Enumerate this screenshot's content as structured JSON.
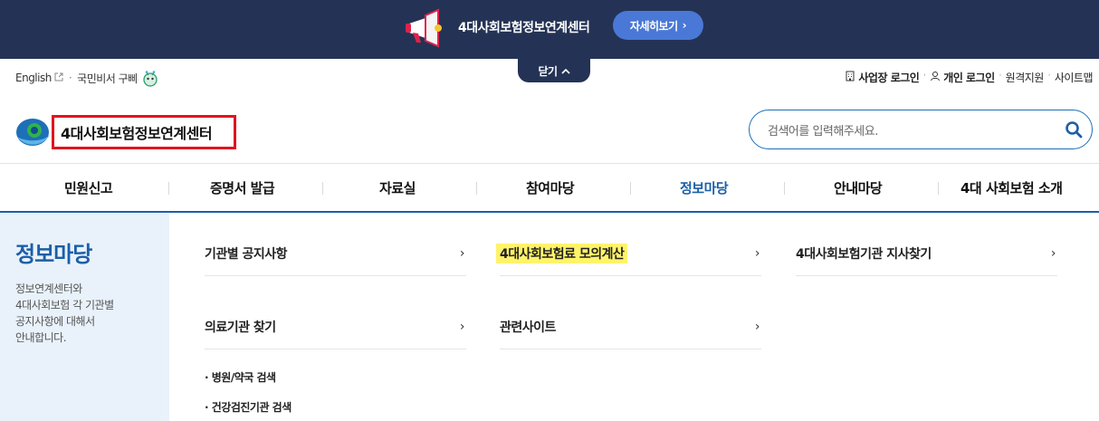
{
  "banner": {
    "title": "4대사회보험정보연계센터",
    "more_label": "자세히보기",
    "more_icon": "chevron-right-icon",
    "close_label": "닫기",
    "close_icon": "chevron-up-icon"
  },
  "util": {
    "english_label": "English",
    "secretary_label": "국민비서 구삐",
    "business_login": "사업장 로그인",
    "personal_login": "개인 로그인",
    "remote_support": "원격지원",
    "sitemap": "사이트맵"
  },
  "logo": {
    "text": "4대사회보험정보연계센터"
  },
  "search": {
    "placeholder": "검색어를 입력해주세요."
  },
  "gnb": {
    "items": [
      "민원신고",
      "증명서 발급",
      "자료실",
      "참여마당",
      "정보마당",
      "안내마당",
      "4대 사회보험 소개"
    ],
    "active": "정보마당"
  },
  "panel": {
    "title": "정보마당",
    "desc_lines": [
      "정보연계센터와",
      "4대사회보험 각 기관별",
      "공지사항에 대해서",
      "안내합니다."
    ]
  },
  "menu": {
    "col1": [
      "기관별 공지사항",
      "의료기관 찾기"
    ],
    "col2": [
      "4대사회보험료 모의계산",
      "관련사이트"
    ],
    "col3": [
      "4대사회보험기관 지사찾기"
    ],
    "sub_items": [
      "병원/약국 검색",
      "건강검진기관 검색"
    ]
  },
  "colors": {
    "banner_bg": "#243355",
    "accent": "#1b5fa8",
    "highlight": "#fff36a",
    "panel_bg": "#e9f2fb"
  }
}
